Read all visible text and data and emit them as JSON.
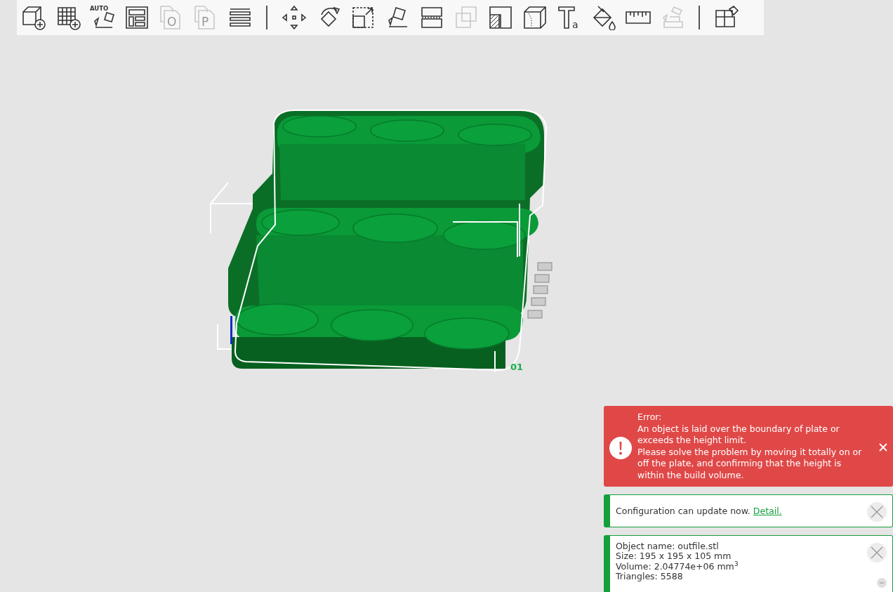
{
  "toolbar": [
    {
      "kind": "tool",
      "disabled": false
    },
    {
      "kind": "tool",
      "disabled": false
    },
    {
      "kind": "tool",
      "disabled": false,
      "label": "AUTO"
    },
    {
      "kind": "tool",
      "disabled": false
    },
    {
      "kind": "tool",
      "disabled": true,
      "label": "O"
    },
    {
      "kind": "tool",
      "disabled": true,
      "label": "P"
    },
    {
      "kind": "tool",
      "disabled": false
    },
    {
      "kind": "separator"
    },
    {
      "kind": "tool",
      "disabled": false
    },
    {
      "kind": "tool",
      "disabled": false
    },
    {
      "kind": "tool",
      "disabled": false
    },
    {
      "kind": "tool",
      "disabled": false
    },
    {
      "kind": "tool",
      "disabled": false
    },
    {
      "kind": "tool",
      "disabled": true
    },
    {
      "kind": "tool",
      "disabled": false
    },
    {
      "kind": "tool",
      "disabled": false
    },
    {
      "kind": "tool",
      "disabled": false,
      "label": "a"
    },
    {
      "kind": "tool",
      "disabled": false
    },
    {
      "kind": "tool",
      "disabled": false
    },
    {
      "kind": "tool",
      "disabled": true
    },
    {
      "kind": "separator"
    },
    {
      "kind": "tool",
      "disabled": false
    }
  ],
  "viewport": {
    "plate_label": "01"
  },
  "notifications": [
    {
      "kind": "error",
      "lines": [
        "Error:",
        "An object is laid over the boundary of plate or exceeds the height limit.",
        "Please solve the problem by moving it totally on or off the plate, and confirming that the height is within the build volume."
      ]
    },
    {
      "kind": "info",
      "lines": [
        "Configuration can update now."
      ],
      "link": "Detail."
    },
    {
      "kind": "info",
      "lines": [
        "Object name: outfile.stl",
        "Size: 195 x 195 x 105 mm",
        "Volume: 2.04774e+06 mm$^{3}$",
        "Triangles: 5588"
      ],
      "collapse": true
    }
  ]
}
